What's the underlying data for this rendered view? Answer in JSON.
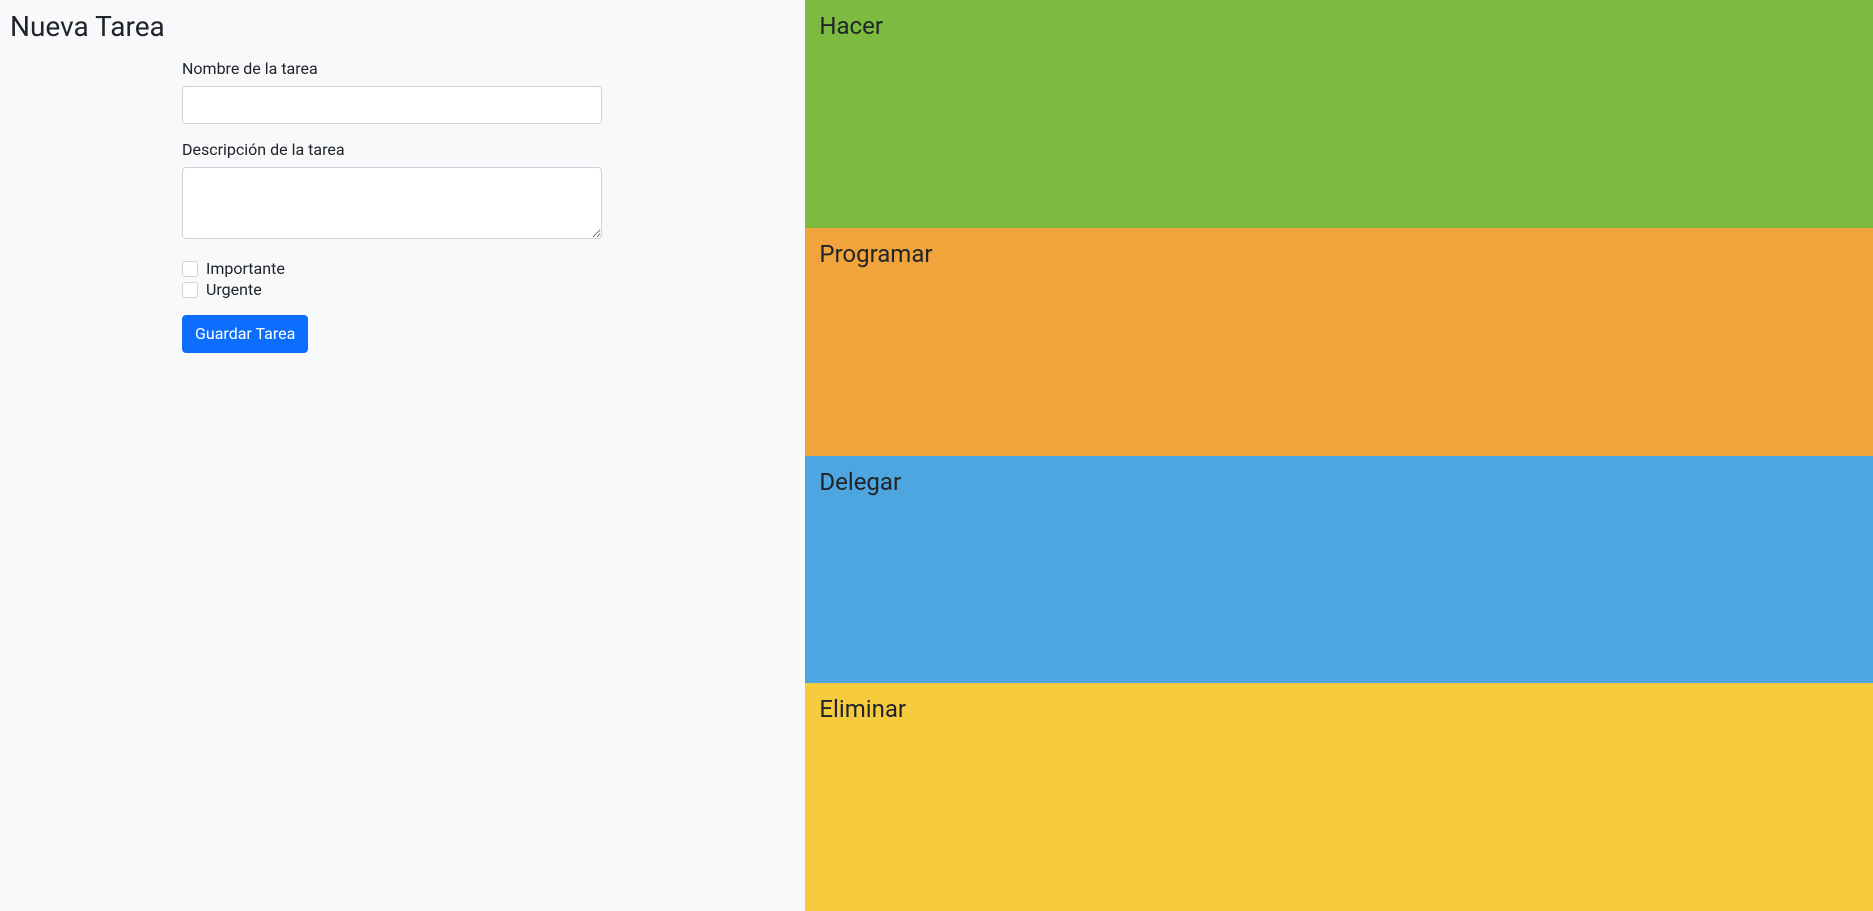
{
  "form": {
    "title": "Nueva Tarea",
    "name_label": "Nombre de la tarea",
    "name_value": "",
    "description_label": "Descripción de la tarea",
    "description_value": "",
    "important_label": "Importante",
    "urgent_label": "Urgente",
    "submit_label": "Guardar Tarea"
  },
  "quadrants": {
    "hacer": "Hacer",
    "programar": "Programar",
    "delegar": "Delegar",
    "eliminar": "Eliminar"
  }
}
